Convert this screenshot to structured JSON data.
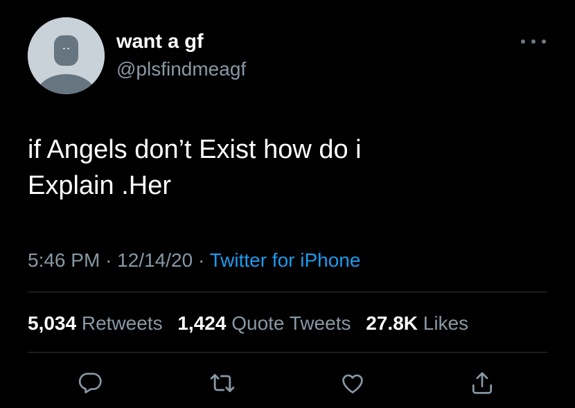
{
  "user": {
    "display_name": "want a gf",
    "handle": "@plsfindmeagf"
  },
  "tweet": {
    "text_line1": "if Angels don’t Exist how do i",
    "text_line2": "Explain .Her",
    "time": "5:46 PM",
    "date": "12/14/20",
    "separator": "·",
    "source": "Twitter for iPhone"
  },
  "stats": {
    "retweets_count": "5,034",
    "retweets_label": "Retweets",
    "quotes_count": "1,424",
    "quotes_label": "Quote Tweets",
    "likes_count": "27.8K",
    "likes_label": "Likes"
  },
  "icons": {
    "avatar": "default-avatar-icon",
    "more": "more-icon",
    "reply": "reply-icon",
    "retweet": "retweet-icon",
    "like": "heart-icon",
    "share": "share-icon"
  },
  "colors": {
    "background": "#000000",
    "text": "#ffffff",
    "secondary": "#8899a6",
    "link": "#1d9bf0",
    "divider": "#2f3336"
  }
}
